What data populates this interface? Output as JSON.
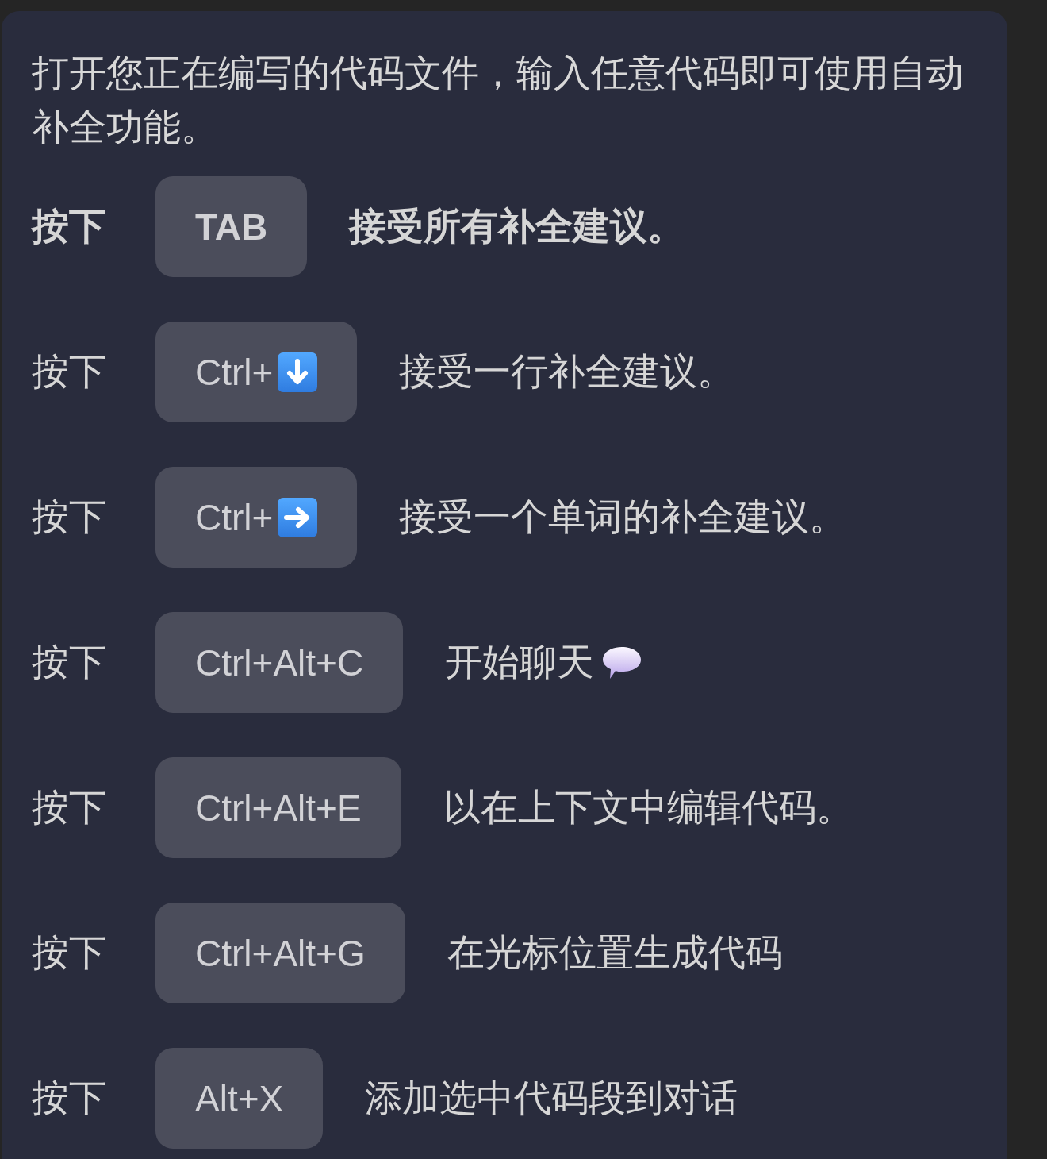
{
  "intro": "打开您正在编写的代码文件，输入任意代码即可使用自动补全功能。",
  "shortcuts": [
    {
      "press": "按下",
      "strong": true,
      "key": {
        "label": "TAB",
        "kind": "plain"
      },
      "description": {
        "text": "接受所有补全建议。",
        "kind": "plain"
      }
    },
    {
      "press": "按下",
      "strong": false,
      "key": {
        "label": "Ctrl+",
        "kind": "down"
      },
      "description": {
        "text": "接受一行补全建议。",
        "kind": "plain"
      }
    },
    {
      "press": "按下",
      "strong": false,
      "key": {
        "label": "Ctrl+",
        "kind": "right"
      },
      "description": {
        "text": "接受一个单词的补全建议。",
        "kind": "plain"
      }
    },
    {
      "press": "按下",
      "strong": false,
      "key": {
        "label": "Ctrl+Alt+C",
        "kind": "plain"
      },
      "description": {
        "text": "开始聊天",
        "kind": "bubble"
      }
    },
    {
      "press": "按下",
      "strong": false,
      "key": {
        "label": "Ctrl+Alt+E",
        "kind": "plain"
      },
      "description": {
        "text": "以在上下文中编辑代码。",
        "kind": "plain"
      }
    },
    {
      "press": "按下",
      "strong": false,
      "key": {
        "label": "Ctrl+Alt+G",
        "kind": "plain"
      },
      "description": {
        "text": "在光标位置生成代码",
        "kind": "plain"
      }
    },
    {
      "press": "按下",
      "strong": false,
      "key": {
        "label": "Alt+X",
        "kind": "plain"
      },
      "description": {
        "text": "添加选中代码段到对话",
        "kind": "plain"
      }
    }
  ]
}
